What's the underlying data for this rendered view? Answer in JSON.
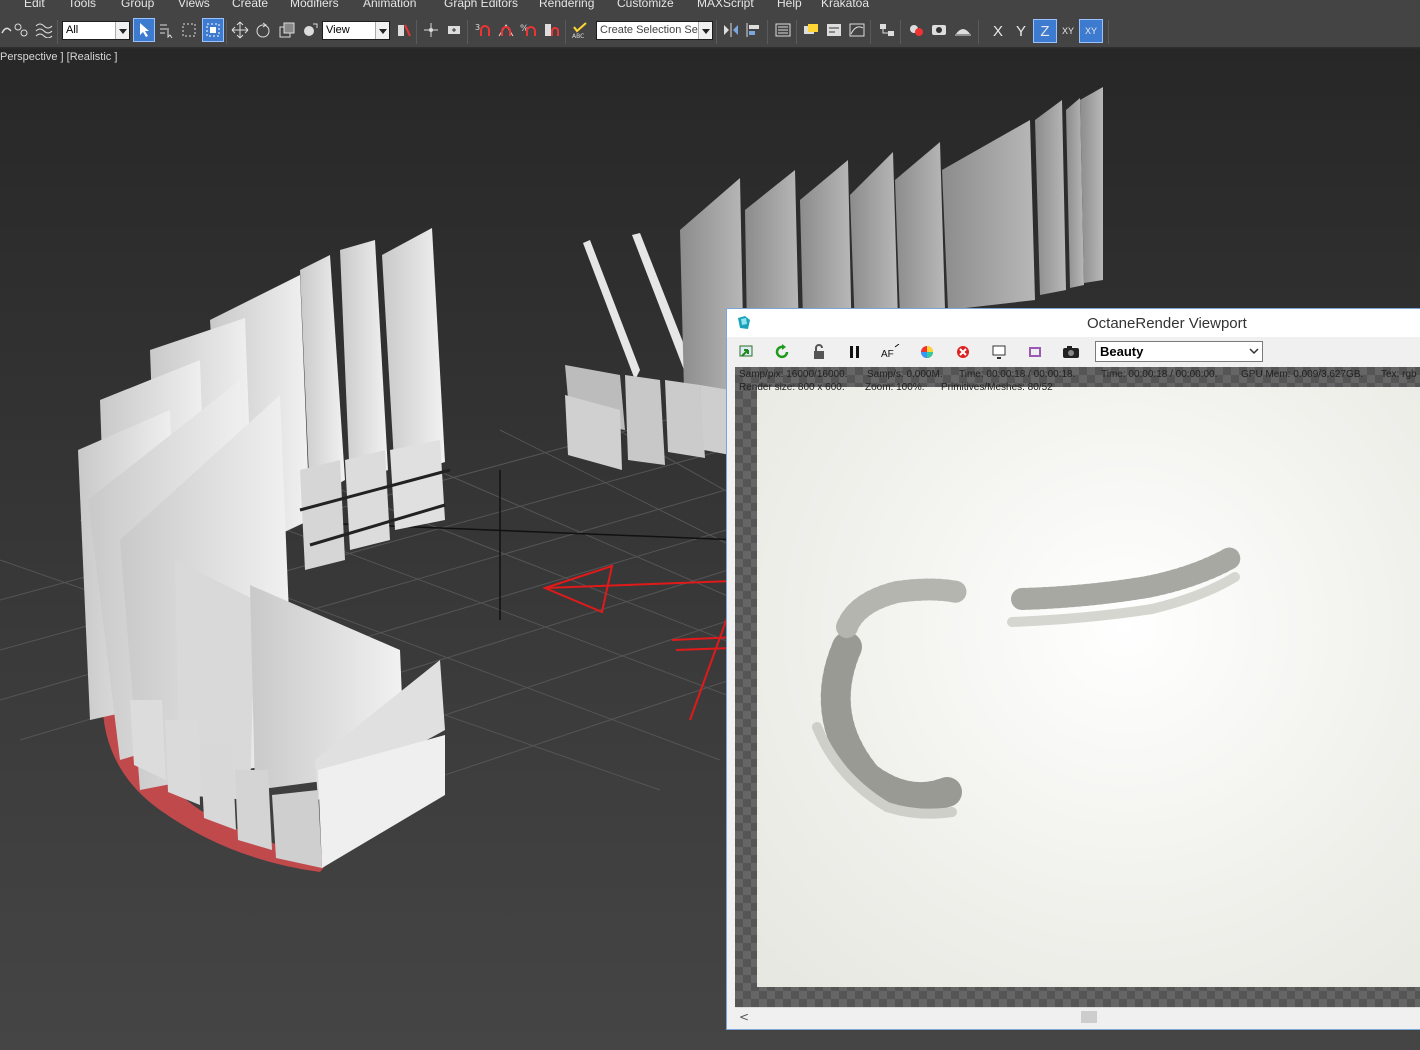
{
  "menu": [
    "Edit",
    "Tools",
    "Group",
    "Views",
    "Create",
    "Modifiers",
    "Animation",
    "Graph Editors",
    "Rendering",
    "Customize",
    "MAXScript",
    "Help",
    "Krakatoa"
  ],
  "toolbar": {
    "selection_filter": "All",
    "ref_coord": "View",
    "named_selection_placeholder": "Create Selection Se",
    "axis_x": "X",
    "axis_y": "Y",
    "axis_z": "Z",
    "axis_xy": "XY",
    "axis_xy2": "XY"
  },
  "viewport": {
    "label": "Perspective ] [Realistic ]",
    "accent_color": "#c9474b",
    "annotation_color": "#e01a1a"
  },
  "octane": {
    "title": "OctaneRender Viewport",
    "pass": "Beauty",
    "stats": {
      "samp_pix": "Samp/pix: 16000/16000.",
      "samp_s": "Samp/s: 0.000M.",
      "time1": "Time: 00:00:18 / 00:00:18.",
      "time2": "Time: 00:00:18 / 00:00:00.",
      "gpu": "GPU Mem: 0.009/3.627GB.",
      "tex": "Tex: rgb",
      "render_size": "Render size: 800 x 600.",
      "zoom": "Zoom: 100%.",
      "prims": "Primitives/Meshes: 80/52"
    },
    "scroll_left": "<"
  }
}
